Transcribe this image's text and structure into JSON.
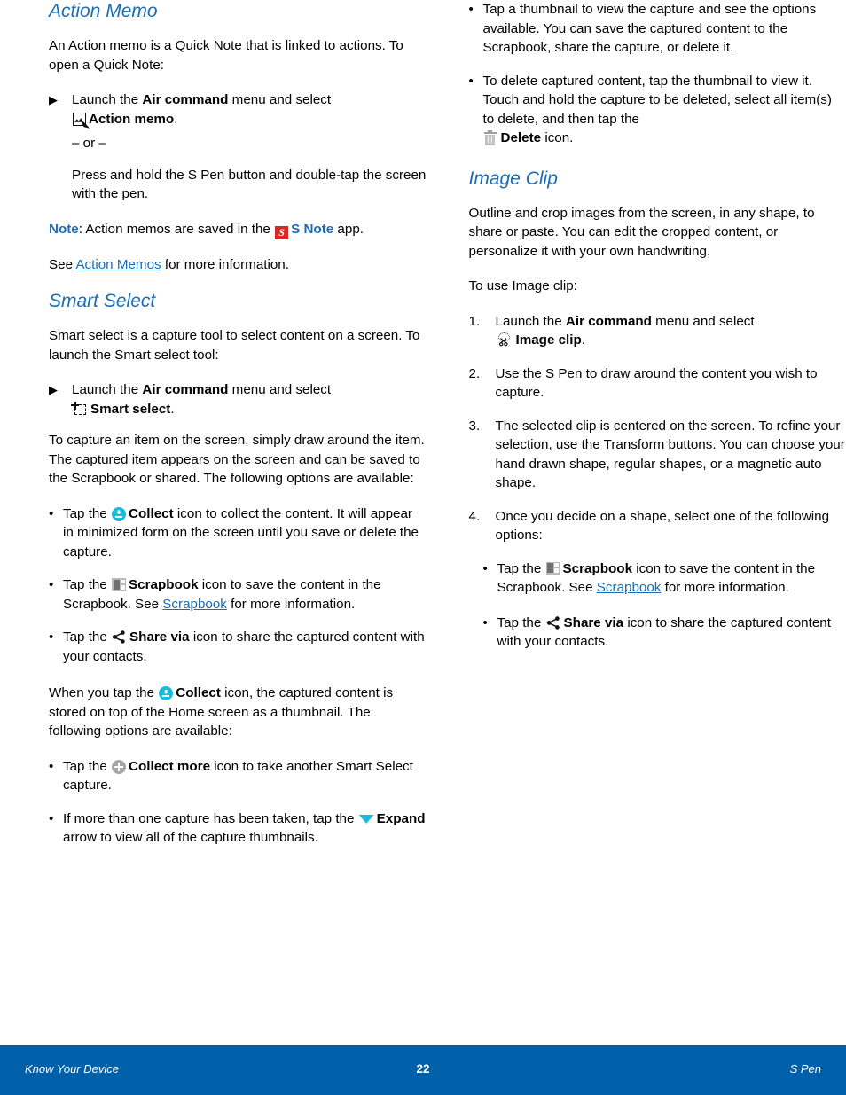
{
  "page": {
    "number": "22"
  },
  "footer": {
    "left": "Know Your Device",
    "center": "22",
    "right": "S Pen",
    "background": "#0060a9",
    "text_color": "#ffffff"
  },
  "colors": {
    "heading": "#1a6db5",
    "link": "#1a6db5",
    "note": "#1a6db5",
    "collect_icon": "#19bcdd",
    "expand_icon": "#19bcdd",
    "snote_icon": "#d62a25",
    "scrapbook_icon": "#6f6f6f",
    "delete_icon": "#9e9e9e",
    "collect_more_icon": "#a6a6a6"
  },
  "left_column": {
    "action_memo": {
      "heading": "Action Memo",
      "intro": "An Action memo is a Quick Note that is linked to actions. To open a Quick Note:",
      "step": {
        "marker": "▶",
        "text_before": "Launch the ",
        "bold_1": "Air command",
        "text_mid": " menu and select",
        "icon_name": "action-memo-icon",
        "bold_2": "Action memo",
        "text_after": "."
      },
      "or_divider": "– or –",
      "alt_step": "Press and hold the S Pen button and double-tap the screen with the pen.",
      "note": {
        "label": "Note",
        "text_before": ": Action memos are saved in the ",
        "icon_name": "s-note-icon",
        "app_name": "S Note",
        "text_after": " app."
      },
      "see_line": {
        "before": "See ",
        "link": "Action Memos",
        "after": " for more information."
      }
    },
    "smart_select": {
      "heading": "Smart Select",
      "intro": "Smart select is a capture tool to select content on a screen. To launch the Smart select tool:",
      "step": {
        "marker": "▶",
        "text_before": "Launch the ",
        "bold_1": "Air command",
        "text_mid": " menu and select",
        "icon_name": "smart-select-icon",
        "bold_2": "Smart select",
        "text_after": "."
      },
      "capture_para": "To capture an item on the screen, simply draw around the item. The captured item appears on the screen and can be saved to the Scrapbook or shared. The following options are available:",
      "bullets": [
        {
          "marker": "•",
          "text_before": "Tap the ",
          "icon_name": "collect-icon",
          "bold": "Collect",
          "text_after": " icon to collect the content. It will appear in minimized form on the screen until you save or delete the capture."
        },
        {
          "marker": "•",
          "text_before": "Tap the ",
          "icon_name": "scrapbook-icon",
          "bold": "Scrapbook",
          "text_after": " icon to save the content in the Scrapbook. See ",
          "link": "Scrapbook",
          "text_end": " for more information."
        },
        {
          "marker": "•",
          "text_before": "Tap the ",
          "icon_name": "share-via-icon",
          "bold": "Share via",
          "text_after": " icon to share the captured content with your contacts."
        }
      ],
      "collect_para": {
        "before": "When you tap the ",
        "icon_name": "collect-icon",
        "bold": "Collect",
        "after": " icon, the captured content is stored on top of the Home screen as a thumbnail. The following options are available:"
      },
      "bullets2": [
        {
          "marker": "•",
          "text_before": "Tap the ",
          "icon_name": "collect-more-icon",
          "bold": "Collect more",
          "text_after": " icon to take another Smart Select capture."
        },
        {
          "marker": "•",
          "text_before": "If more than one capture has been taken, tap the ",
          "icon_name": "expand-icon",
          "bold": "Expand",
          "text_after": " arrow to view all of the capture thumbnails."
        }
      ]
    }
  },
  "right_column": {
    "smart_select_cont": {
      "bullets": [
        {
          "marker": "•",
          "text": "Tap a thumbnail to view the capture and see the options available. You can save the captured content to the Scrapbook, share the capture, or delete it."
        },
        {
          "marker": "•",
          "text_before": "To delete captured content, tap the thumbnail to view it. Touch and hold the capture to be deleted, select all item(s) to delete, and then tap the",
          "icon_name": "delete-icon",
          "bold": "Delete",
          "text_after": " icon."
        }
      ]
    },
    "image_clip": {
      "heading": "Image Clip",
      "intro": "Outline and crop images from the screen, in any shape, to share or paste. You can edit the cropped content, or personalize it with your own handwriting.",
      "lead_in": "To use Image clip:",
      "steps": [
        {
          "number": "1.",
          "text_before": "Launch the ",
          "bold_1": "Air command",
          "text_mid": " menu and select",
          "icon_name": "image-clip-icon",
          "bold_2": "Image clip",
          "text_after": "."
        },
        {
          "number": "2.",
          "text": "Use the S Pen to draw around the content you wish to capture."
        },
        {
          "number": "3.",
          "text": "The selected clip is centered on the screen. To refine your selection, use the Transform buttons. You can choose your hand drawn shape, regular shapes, or a magnetic auto shape."
        },
        {
          "number": "4.",
          "text": "Once you decide on a shape, select one of the following options:"
        }
      ],
      "sub_bullets": [
        {
          "marker": "•",
          "text_before": "Tap the ",
          "icon_name": "scrapbook-icon",
          "bold": "Scrapbook",
          "text_after": " icon to save the content in the Scrapbook. See ",
          "link": "Scrapbook",
          "text_end": " for more information."
        },
        {
          "marker": "•",
          "text_before": "Tap the ",
          "icon_name": "share-via-icon",
          "bold": "Share via",
          "text_after": " icon to share the captured content with your contacts."
        }
      ]
    }
  }
}
